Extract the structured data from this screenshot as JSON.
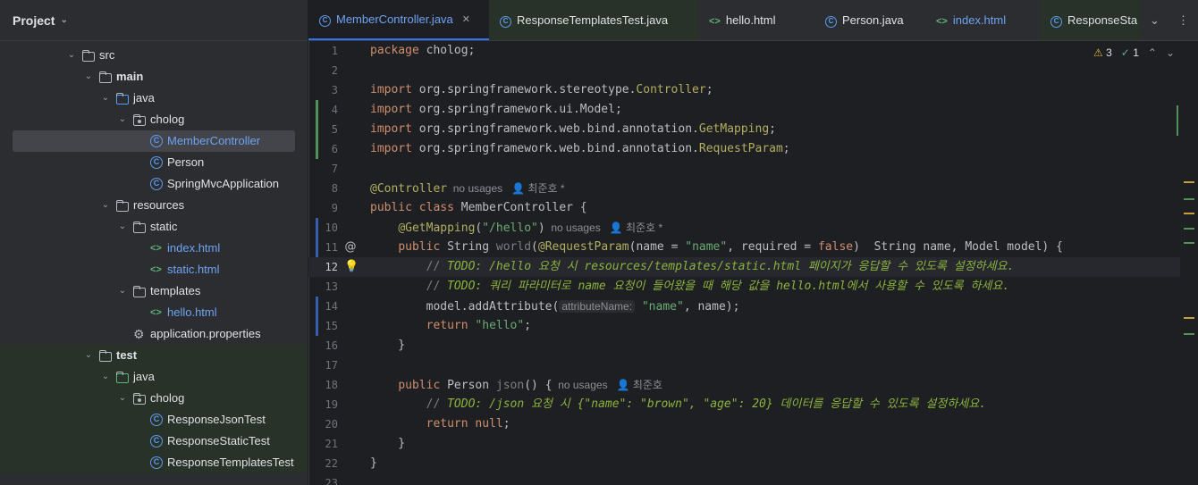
{
  "project": {
    "title": "Project",
    "tree": [
      {
        "name": "src",
        "type": "folder",
        "depth": 0,
        "expanded": true
      },
      {
        "name": "main",
        "type": "source-folder",
        "depth": 1,
        "expanded": true,
        "bold": true
      },
      {
        "name": "java",
        "type": "folder-blue",
        "depth": 2,
        "expanded": true
      },
      {
        "name": "cholog",
        "type": "package",
        "depth": 3,
        "expanded": true
      },
      {
        "name": "MemberController",
        "type": "class",
        "depth": 4,
        "selected": true
      },
      {
        "name": "Person",
        "type": "class",
        "depth": 4
      },
      {
        "name": "SpringMvcApplication",
        "type": "class",
        "depth": 4
      },
      {
        "name": "resources",
        "type": "resources-folder",
        "depth": 2,
        "expanded": true
      },
      {
        "name": "static",
        "type": "folder",
        "depth": 3,
        "expanded": true
      },
      {
        "name": "index.html",
        "type": "html",
        "depth": 4
      },
      {
        "name": "static.html",
        "type": "html",
        "depth": 4
      },
      {
        "name": "templates",
        "type": "folder",
        "depth": 3,
        "expanded": true
      },
      {
        "name": "hello.html",
        "type": "html",
        "depth": 4
      },
      {
        "name": "application.properties",
        "type": "properties",
        "depth": 3
      },
      {
        "name": "test",
        "type": "test-folder",
        "depth": 1,
        "expanded": true,
        "bold": true,
        "test": true
      },
      {
        "name": "java",
        "type": "folder-green",
        "depth": 2,
        "expanded": true,
        "test": true
      },
      {
        "name": "cholog",
        "type": "package",
        "depth": 3,
        "expanded": true,
        "test": true
      },
      {
        "name": "ResponseJsonTest",
        "type": "class",
        "depth": 4,
        "test": true
      },
      {
        "name": "ResponseStaticTest",
        "type": "class",
        "depth": 4,
        "test": true
      },
      {
        "name": "ResponseTemplatesTest",
        "type": "class",
        "depth": 4,
        "test": true
      }
    ]
  },
  "tabs": [
    {
      "label": "MemberController.java",
      "icon": "class-icon",
      "active": true
    },
    {
      "label": "ResponseTemplatesTest.java",
      "icon": "class-icon",
      "test": true
    },
    {
      "label": "hello.html",
      "icon": "html-icon"
    },
    {
      "label": "Person.java",
      "icon": "class-icon"
    },
    {
      "label": "index.html",
      "icon": "html-icon",
      "blue": true
    },
    {
      "label": "ResponseSta",
      "icon": "class-icon",
      "test": true
    }
  ],
  "inspections": {
    "warnings": "3",
    "checks": "1"
  },
  "editor": {
    "current_line": 12,
    "lines": [
      {
        "n": "1",
        "code": [
          [
            "kw",
            "package"
          ],
          [
            "cls",
            " cholog;"
          ]
        ]
      },
      {
        "n": "2",
        "code": []
      },
      {
        "n": "3",
        "code": [
          [
            "kw",
            "import"
          ],
          [
            "cls",
            " org.springframework.stereotype."
          ],
          [
            "ann",
            "Controller"
          ],
          [
            "cls",
            ";"
          ]
        ]
      },
      {
        "n": "4",
        "code": [
          [
            "kw",
            "import"
          ],
          [
            "cls",
            " org.springframework.ui.Model;"
          ]
        ],
        "gutter": "green"
      },
      {
        "n": "5",
        "code": [
          [
            "kw",
            "import"
          ],
          [
            "cls",
            " org.springframework.web.bind.annotation."
          ],
          [
            "ann",
            "GetMapping"
          ],
          [
            "cls",
            ";"
          ]
        ],
        "gutter": "green"
      },
      {
        "n": "6",
        "code": [
          [
            "kw",
            "import"
          ],
          [
            "cls",
            " org.springframework.web.bind.annotation."
          ],
          [
            "ann",
            "RequestParam"
          ],
          [
            "cls",
            ";"
          ]
        ],
        "gutter": "green"
      },
      {
        "n": "7",
        "code": []
      },
      {
        "n": "8",
        "code": [
          [
            "ann",
            "@Controller"
          ],
          [
            "hint",
            "  no usages   "
          ],
          [
            "hint",
            "👤 최준호 *"
          ]
        ]
      },
      {
        "n": "9",
        "code": [
          [
            "kw",
            "public class"
          ],
          [
            "cls",
            " MemberController {"
          ]
        ]
      },
      {
        "n": "10",
        "code": [
          [
            "cls",
            "    "
          ],
          [
            "ann",
            "@GetMapping"
          ],
          [
            "cls",
            "("
          ],
          [
            "str",
            "\"/hello\""
          ],
          [
            "cls",
            ")"
          ],
          [
            "hint",
            "  no usages   "
          ],
          [
            "hint",
            "👤 최준호 *"
          ]
        ],
        "gutter": "blue"
      },
      {
        "n": "11",
        "code": [
          [
            "cls",
            "    "
          ],
          [
            "kw",
            "public"
          ],
          [
            "cls",
            " String "
          ],
          [
            "mute",
            "world"
          ],
          [
            "cls",
            "("
          ],
          [
            "ann",
            "@RequestParam"
          ],
          [
            "cls",
            "(name = "
          ],
          [
            "str",
            "\"name\""
          ],
          [
            "cls",
            ", required = "
          ],
          [
            "kw",
            "false"
          ],
          [
            "cls",
            ")  String name, Model model) {"
          ]
        ],
        "gutter": "blue",
        "icon": "@"
      },
      {
        "n": "12",
        "code": [
          [
            "cls",
            "        "
          ],
          [
            "cmt",
            "// "
          ],
          [
            "todo",
            "TODO: /hello 요청 시 resources/templates/static.html 페이지가 응답할 수 있도록 설정하세요."
          ]
        ],
        "icon": "💡"
      },
      {
        "n": "13",
        "code": [
          [
            "cls",
            "        "
          ],
          [
            "cmt",
            "// "
          ],
          [
            "todo",
            "TODO: 쿼리 파라미터로 name 요청이 들어왔을 때 해당 값을 hello.html에서 사용할 수 있도록 하세요."
          ]
        ]
      },
      {
        "n": "14",
        "code": [
          [
            "cls",
            "        model.addAttribute("
          ],
          [
            "inlay",
            "attributeName:"
          ],
          [
            "str",
            " \"name\""
          ],
          [
            "cls",
            ", name);"
          ]
        ],
        "gutter": "blue"
      },
      {
        "n": "15",
        "code": [
          [
            "cls",
            "        "
          ],
          [
            "kw",
            "return"
          ],
          [
            "str",
            " \"hello\""
          ],
          [
            "cls",
            ";"
          ]
        ],
        "gutter": "blue"
      },
      {
        "n": "16",
        "code": [
          [
            "cls",
            "    }"
          ]
        ]
      },
      {
        "n": "17",
        "code": []
      },
      {
        "n": "18",
        "code": [
          [
            "cls",
            "    "
          ],
          [
            "kw",
            "public"
          ],
          [
            "cls",
            " Person "
          ],
          [
            "mute",
            "json"
          ],
          [
            "cls",
            "() {"
          ],
          [
            "hint",
            "  no usages   "
          ],
          [
            "hint",
            "👤 최준호"
          ]
        ]
      },
      {
        "n": "19",
        "code": [
          [
            "cls",
            "        "
          ],
          [
            "cmt",
            "// "
          ],
          [
            "todo",
            "TODO: /json 요청 시 {\"name\": \"brown\", \"age\": 20} 데이터를 응답할 수 있도록 설정하세요."
          ]
        ]
      },
      {
        "n": "20",
        "code": [
          [
            "cls",
            "        "
          ],
          [
            "kw",
            "return null"
          ],
          [
            "cls",
            ";"
          ]
        ]
      },
      {
        "n": "21",
        "code": [
          [
            "cls",
            "    }"
          ]
        ]
      },
      {
        "n": "22",
        "code": [
          [
            "cls",
            "}"
          ]
        ]
      },
      {
        "n": "23",
        "code": []
      }
    ]
  },
  "colors": {
    "accent": "#3574f0",
    "test_bg": "#283228",
    "selection": "#43454a"
  }
}
